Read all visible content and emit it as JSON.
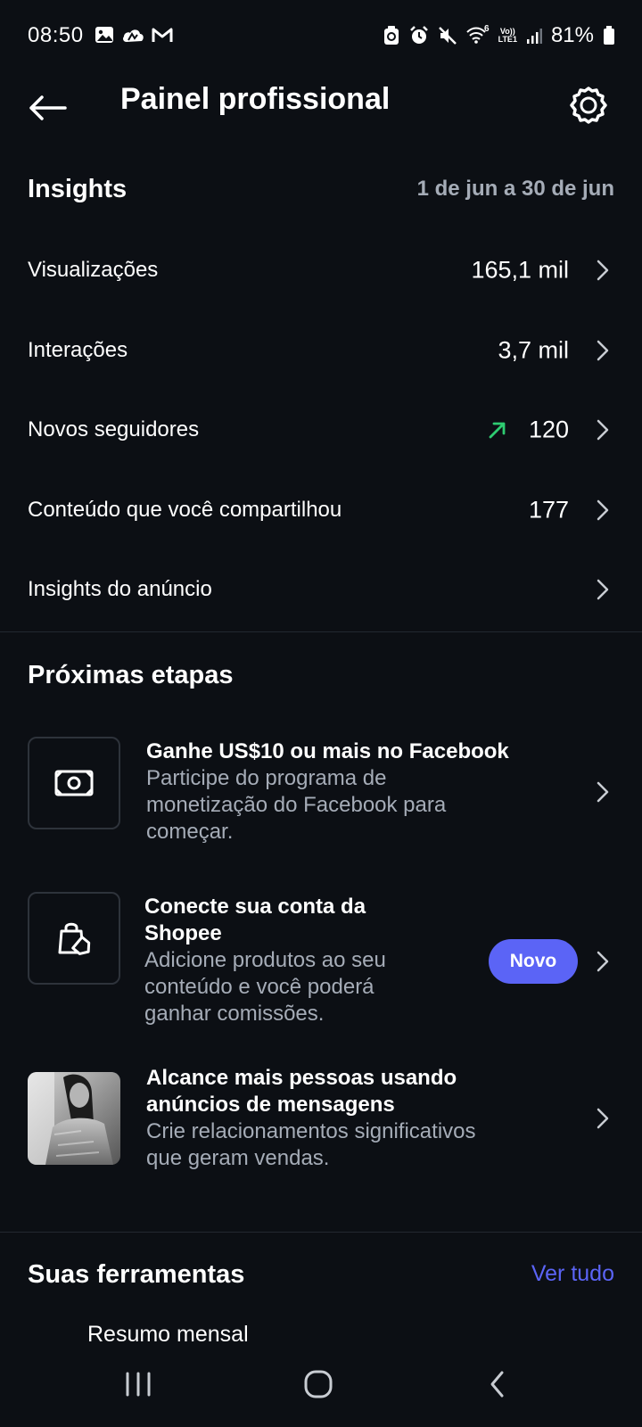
{
  "status_bar": {
    "time": "08:50",
    "battery": "81%",
    "volte_top": "Vo))",
    "volte_bottom": "LTE1",
    "net_sup": "6",
    "icons": [
      "gallery-icon",
      "cloud-icon",
      "gmail-icon",
      "app-icon",
      "alarm-icon",
      "mute-icon",
      "wifi-icon",
      "signal-icon",
      "battery-icon"
    ]
  },
  "header": {
    "title": "Painel profissional"
  },
  "insights": {
    "title": "Insights",
    "date_range": "1 de jun a 30 de jun",
    "rows": [
      {
        "label": "Visualizações",
        "value": "165,1 mil"
      },
      {
        "label": "Interações",
        "value": "3,7 mil"
      },
      {
        "label": "Novos seguidores",
        "value": "120",
        "trend": "up"
      },
      {
        "label": "Conteúdo que você compartilhou",
        "value": "177"
      },
      {
        "label": "Insights do anúncio",
        "value": ""
      }
    ]
  },
  "next_steps": {
    "title": "Próximas etapas",
    "cards": [
      {
        "icon": "money-icon",
        "title": "Ganhe US$10 ou mais no Facebook",
        "description": [
          "Participe do programa de",
          "monetização do Facebook para",
          "começar."
        ]
      },
      {
        "icon": "shopping-bag-tag-icon",
        "title": [
          "Conecte sua conta da",
          "Shopee"
        ],
        "description": [
          "Adicione produtos ao seu",
          "conteúdo e você poderá",
          "ganhar comissões."
        ],
        "badge": "Novo"
      },
      {
        "icon": "woman-photo-thumbnail",
        "title": [
          "Alcance mais pessoas usando",
          "anúncios de mensagens"
        ],
        "description": [
          "Crie relacionamentos significativos",
          "que geram vendas."
        ]
      }
    ]
  },
  "tools": {
    "title": "Suas ferramentas",
    "see_all": "Ver tudo",
    "first_item": "Resumo mensal"
  },
  "colors": {
    "background": "#0c0f14",
    "secondary_text": "#a5acb7",
    "accent": "#5b64f6",
    "trend_up": "#2ecc71"
  }
}
